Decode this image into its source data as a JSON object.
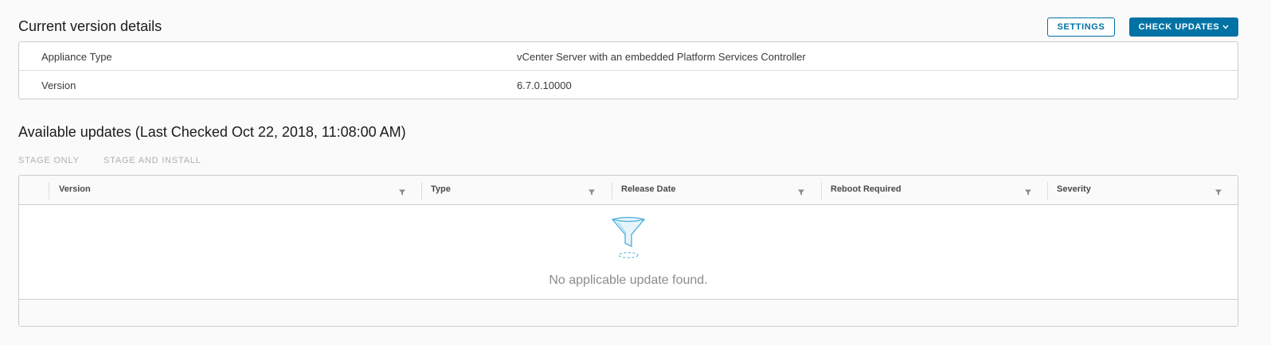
{
  "current_section": {
    "title": "Current version details",
    "details": [
      {
        "label": "Appliance Type",
        "value": "vCenter Server with an embedded Platform Services Controller"
      },
      {
        "label": "Version",
        "value": "6.7.0.10000"
      }
    ]
  },
  "toolbar": {
    "settings_label": "SETTINGS",
    "check_updates_label": "CHECK UPDATES"
  },
  "updates_section": {
    "title": "Available updates (Last Checked Oct 22, 2018, 11:08:00 AM)",
    "actions": {
      "stage_only": "STAGE ONLY",
      "stage_and_install": "STAGE AND INSTALL"
    },
    "columns": [
      "Version",
      "Type",
      "Release Date",
      "Reboot Required",
      "Severity"
    ],
    "empty_message": "No applicable update found."
  },
  "icons": {
    "filter": "filter-icon",
    "empty": "funnel-icon",
    "dropdown": "chevron-down-icon"
  },
  "colors": {
    "primary": "#0072a3",
    "empty_icon": "#49afd9"
  }
}
